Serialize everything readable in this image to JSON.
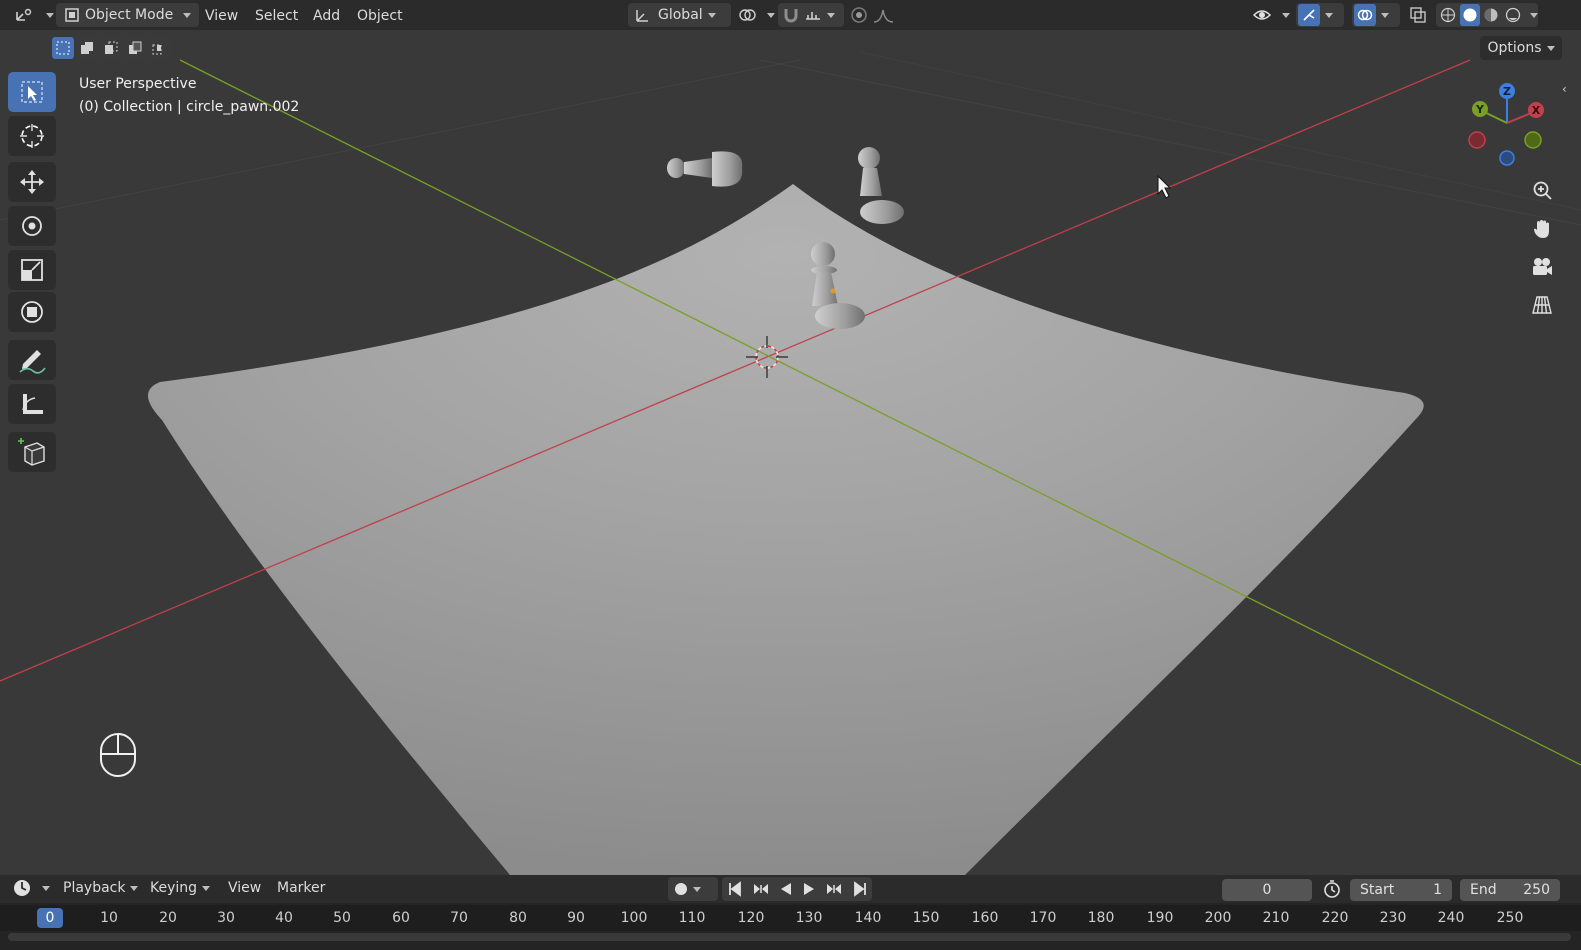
{
  "header": {
    "mode_label": "Object Mode",
    "menus": [
      "View",
      "Select",
      "Add",
      "Object"
    ],
    "transform_orientation": "Global",
    "options_label": "Options"
  },
  "viewport": {
    "view_name": "User Perspective",
    "collection_info": "(0) Collection | circle_pawn.002",
    "gizmo": {
      "x": "X",
      "y": "Y",
      "z": "Z"
    }
  },
  "timeline": {
    "menus": [
      "Playback",
      "Keying",
      "View",
      "Marker"
    ],
    "current_frame": "0",
    "start_label": "Start",
    "start_value": "1",
    "end_label": "End",
    "end_value": "250",
    "ruler": [
      "0",
      "10",
      "20",
      "30",
      "40",
      "50",
      "60",
      "70",
      "80",
      "90",
      "100",
      "110",
      "120",
      "130",
      "140",
      "150",
      "160",
      "170",
      "180",
      "190",
      "200",
      "210",
      "220",
      "230",
      "240",
      "250"
    ]
  },
  "colors": {
    "accent": "#4772b3",
    "x_axis": "#c0404c",
    "y_axis": "#7a9f26",
    "z_axis": "#3d7fe0",
    "background": "#393939"
  }
}
